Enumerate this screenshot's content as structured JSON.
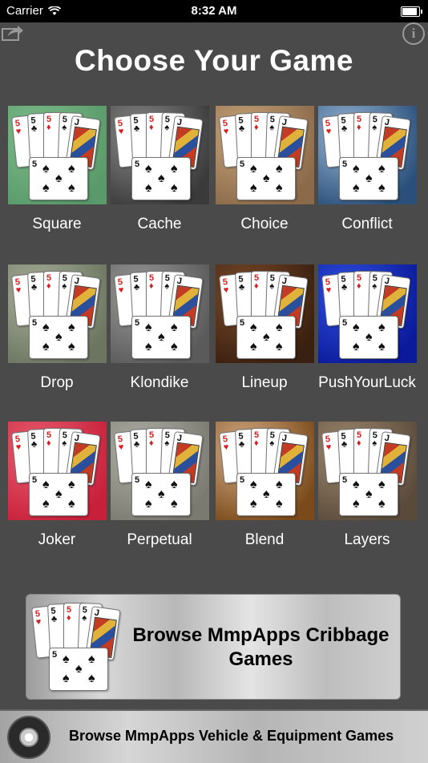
{
  "status_bar": {
    "carrier": "Carrier",
    "time": "8:32 AM"
  },
  "header": {
    "title": "Choose Your Game",
    "share_icon": "share-icon",
    "info_icon": "info-icon",
    "info_glyph": "i"
  },
  "games": [
    {
      "label": "Square",
      "background": "#5a9a6a",
      "background2": "#7dbb8a"
    },
    {
      "label": "Cache",
      "background": "#3a3a3a",
      "background2": "#8a8a8a"
    },
    {
      "label": "Choice",
      "background": "#8a6a4a",
      "background2": "#c9a47a"
    },
    {
      "label": "Conflict",
      "background": "#2a4f7a",
      "background2": "#9ab8d6"
    },
    {
      "label": "Drop",
      "background": "#6b7560",
      "background2": "#a9b09a"
    },
    {
      "label": "Klondike",
      "background": "#5a5a5a",
      "background2": "#9a9a9a"
    },
    {
      "label": "Lineup",
      "background": "#3a2010",
      "background2": "#7a4a28"
    },
    {
      "label": "PushYourLuck",
      "background": "#0a1a9a",
      "background2": "#3050e0"
    },
    {
      "label": "Joker",
      "background": "#c8203a",
      "background2": "#e86070"
    },
    {
      "label": "Perpetual",
      "background": "#7a7a70",
      "background2": "#b0b0a6"
    },
    {
      "label": "Blend",
      "background": "#7a4a1a",
      "background2": "#d9b08a"
    },
    {
      "label": "Layers",
      "background": "#5a4a3a",
      "background2": "#a08a70"
    }
  ],
  "cards": {
    "rank_five": "5",
    "rank_jack": "J",
    "suit_heart": "♥",
    "suit_club": "♣",
    "suit_diamond": "♦",
    "suit_spade": "♠"
  },
  "promo": {
    "cribbage_line1": "Browse MmpApps Cribbage",
    "cribbage_line2": "Games",
    "vehicle": "Browse MmpApps Vehicle & Equipment Games"
  }
}
